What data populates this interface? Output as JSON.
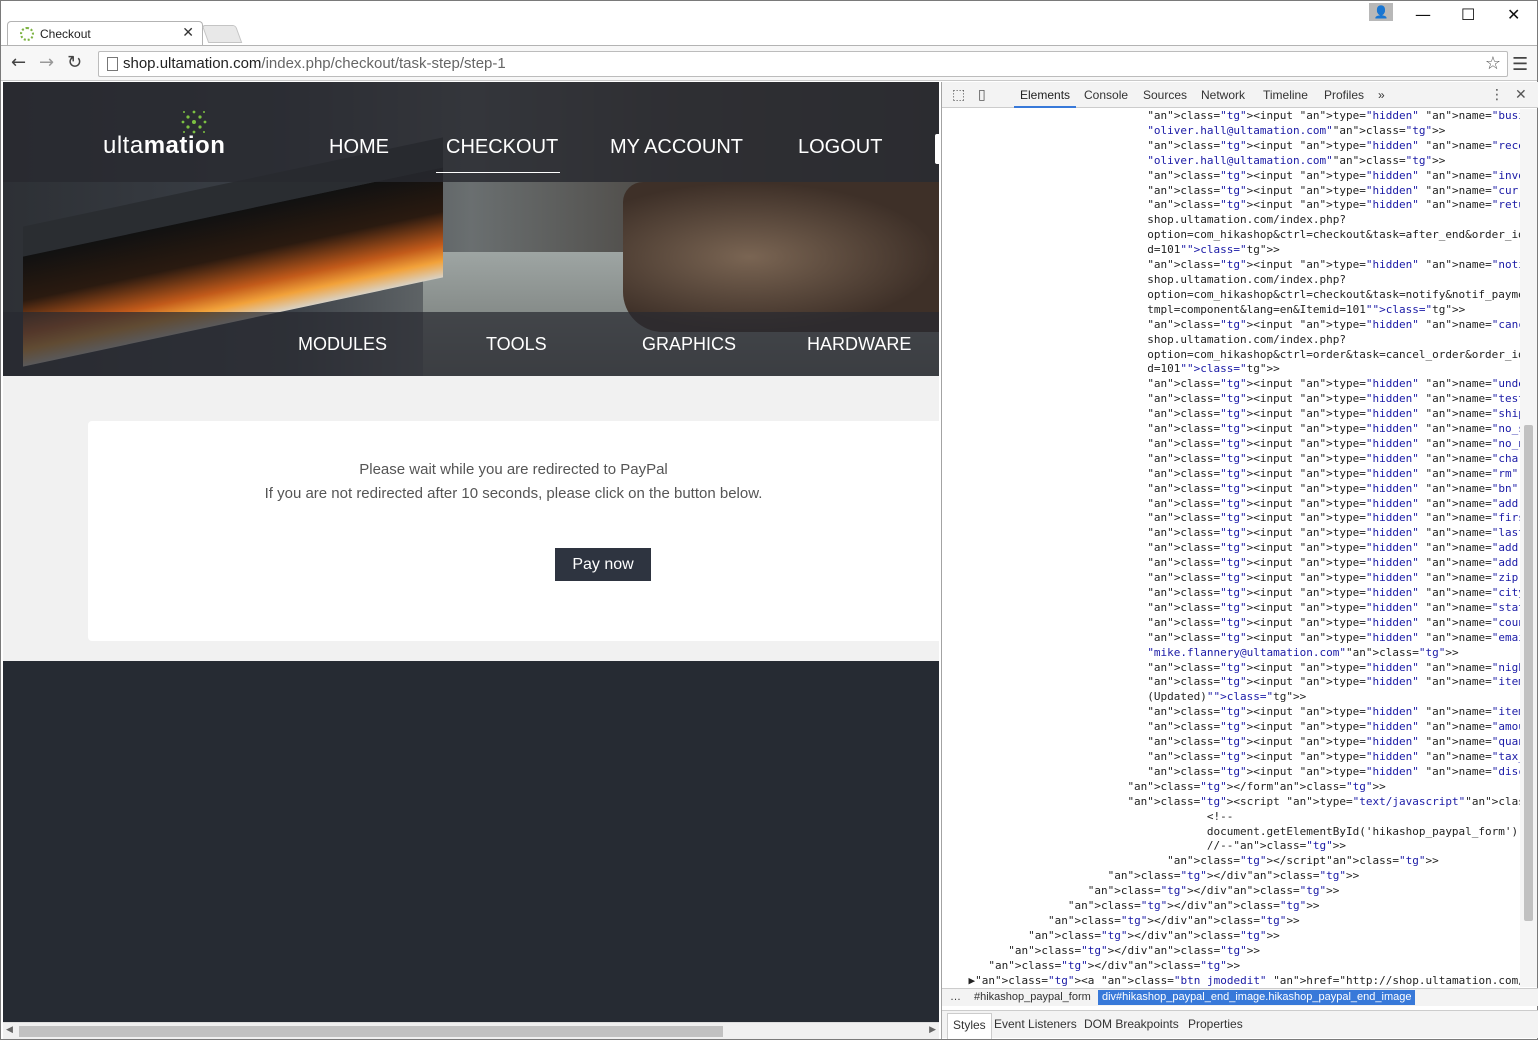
{
  "browser": {
    "tab_title": "Checkout",
    "tab_close": "✕",
    "url_host": "shop.ultamation.com",
    "url_path": "/index.php/checkout/task-step/step-1",
    "profile_icon": "👤"
  },
  "site": {
    "logo_light": "ulta",
    "logo_bold": "mation",
    "nav_top": [
      "HOME",
      "CHECKOUT",
      "MY ACCOUNT",
      "LOGOUT"
    ],
    "nav_bottom": [
      "MODULES",
      "TOOLS",
      "GRAPHICS",
      "HARDWARE"
    ]
  },
  "checkout": {
    "message_line1": "Please wait while you are redirected to PayPal",
    "message_line2": "If you are not redirected after 10 seconds, please click on the button below.",
    "pay_button": "Pay now"
  },
  "devtools": {
    "tabs": [
      "Elements",
      "Console",
      "Sources",
      "Network",
      "Timeline",
      "Profiles",
      "»"
    ],
    "breadcrumb_more": "…",
    "breadcrumb_1": "#hikashop_paypal_form",
    "breadcrumb_2": "div#hikashop_paypal_end_image.hikashop_paypal_end_image",
    "subtabs": [
      "Styles",
      "Event Listeners",
      "DOM Breakpoints",
      "Properties"
    ]
  }
}
